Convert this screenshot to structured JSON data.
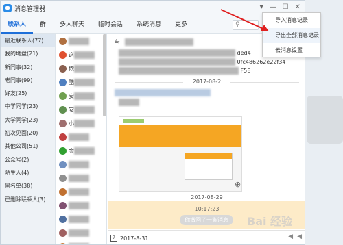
{
  "window": {
    "title": "消息管理器"
  },
  "nav": {
    "tabs": [
      "联系人",
      "群",
      "多人聊天",
      "临时会话",
      "系统消息",
      "更多"
    ]
  },
  "groups": [
    "最近联系人(77)",
    "我的地盘(21)",
    "新同事(32)",
    "老同事(99)",
    "好友(25)",
    "中学同学(23)",
    "大学同学(23)",
    "初次见面(20)",
    "其他公司(51)",
    "公众号(2)",
    "陌生人(4)",
    "黑名单(38)",
    "已删除联系人(3)"
  ],
  "contacts": [
    {
      "color": "#b07040",
      "name": ""
    },
    {
      "color": "#e05030",
      "name": "这"
    },
    {
      "color": "#8a6050",
      "name": "侬"
    },
    {
      "color": "#5080c0",
      "name": "酷"
    },
    {
      "color": "#70a050",
      "name": "安"
    },
    {
      "color": "#609050",
      "name": "安"
    },
    {
      "color": "#a07070",
      "name": "小"
    },
    {
      "color": "#c04040",
      "name": ""
    },
    {
      "color": "#30a030",
      "name": "金"
    },
    {
      "color": "#7090c0",
      "name": ""
    },
    {
      "color": "#909090",
      "name": ""
    },
    {
      "color": "#c07030",
      "name": ""
    },
    {
      "color": "#805070",
      "name": ""
    },
    {
      "color": "#5070a0",
      "name": ""
    },
    {
      "color": "#a06060",
      "name": ""
    },
    {
      "color": "#d08040",
      "name": ""
    }
  ],
  "chat": {
    "header": "与",
    "snippet1": "ded4",
    "snippet2": "0fc486262e22f34",
    "snippet3": "F5E",
    "date1": "2017-08-2",
    "date2": "2017-08-29",
    "revoked_time": "10:17:23",
    "revoked_text": "你撤回了一条消息",
    "footer_date": "2017-8-31"
  },
  "menu": {
    "items": [
      "导入消息记录",
      "导出全部消息记录",
      "云消息设置"
    ]
  },
  "watermark": "Bai 经验"
}
